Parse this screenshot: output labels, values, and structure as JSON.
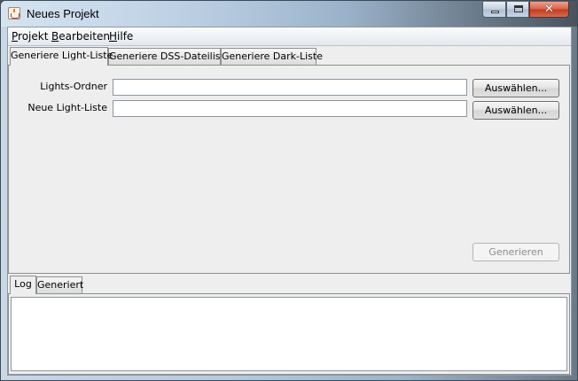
{
  "window": {
    "title": "Neues Projekt",
    "icon": "java-coffee-cup-icon"
  },
  "title_buttons": {
    "minimize": "minimize-icon",
    "maximize": "maximize-icon",
    "close_glyph": "✕"
  },
  "menu": {
    "items": [
      {
        "first": "P",
        "rest": "rojekt"
      },
      {
        "first": "B",
        "rest": "earbeiten"
      },
      {
        "first": "H",
        "rest": "ilfe"
      }
    ]
  },
  "tabs": {
    "top": [
      {
        "label": "Generiere Light-Liste",
        "active": true
      },
      {
        "label": "Generiere DSS-Dateiliste",
        "active": false
      },
      {
        "label": "Generiere Dark-Liste",
        "active": false
      }
    ],
    "bottom": [
      {
        "label": "Log",
        "active": true
      },
      {
        "label": "Generiert",
        "active": false
      }
    ]
  },
  "form": {
    "lights_folder": {
      "label": "Lights-Ordner",
      "value": "",
      "button": "Auswählen..."
    },
    "new_light_list": {
      "label": "Neue Light-Liste",
      "value": "",
      "button": "Auswählen..."
    },
    "generate_button": "Generieren",
    "generate_enabled": false
  },
  "log": {
    "content": ""
  }
}
